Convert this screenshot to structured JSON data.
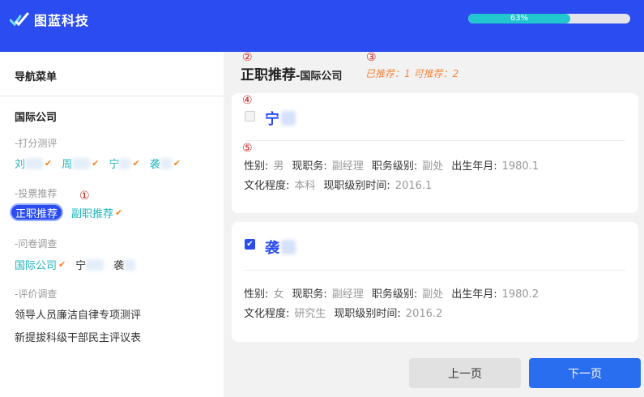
{
  "header": {
    "app_name": "图蓝科技",
    "progress_text": "63%",
    "progress_value": 0.63
  },
  "sidebar": {
    "nav_title": "导航菜单",
    "org_title": "国际公司",
    "sections": [
      {
        "label": "-打分测评",
        "items": [
          "刘",
          "周",
          "宁",
          "袭"
        ]
      },
      {
        "label": "-投票推荐",
        "items": [
          "正职推荐",
          "副职推荐"
        ]
      },
      {
        "label": "-问卷调查",
        "items": [
          "国际公司",
          "宁",
          "袭"
        ]
      },
      {
        "label": "-评价调查",
        "items": [
          "领导人员廉洁自律专项测评",
          "新提拔科级干部民主评议表"
        ]
      }
    ]
  },
  "markers": [
    "①",
    "②",
    "③",
    "④",
    "⑤"
  ],
  "main": {
    "title": "正职推荐",
    "subtitle": "-国际公司",
    "stats": "已推荐：1  可推荐：2",
    "labels": {
      "gender": "性别:",
      "position": "现职务:",
      "level": "职务级别:",
      "birth": "出生年月:",
      "education": "文化程度:",
      "level_time": "现职级别时间:"
    },
    "candidates": [
      {
        "name": "宁",
        "checked": false,
        "gender": "男",
        "position": "副经理",
        "level": "副处",
        "birth": "1980.1",
        "education": "本科",
        "level_time": "2016.1"
      },
      {
        "name": "袭",
        "checked": true,
        "gender": "女",
        "position": "副经理",
        "level": "副处",
        "birth": "1980.2",
        "education": "研究生",
        "level_time": "2016.2"
      }
    ],
    "prev_label": "上一页",
    "next_label": "下一页"
  }
}
